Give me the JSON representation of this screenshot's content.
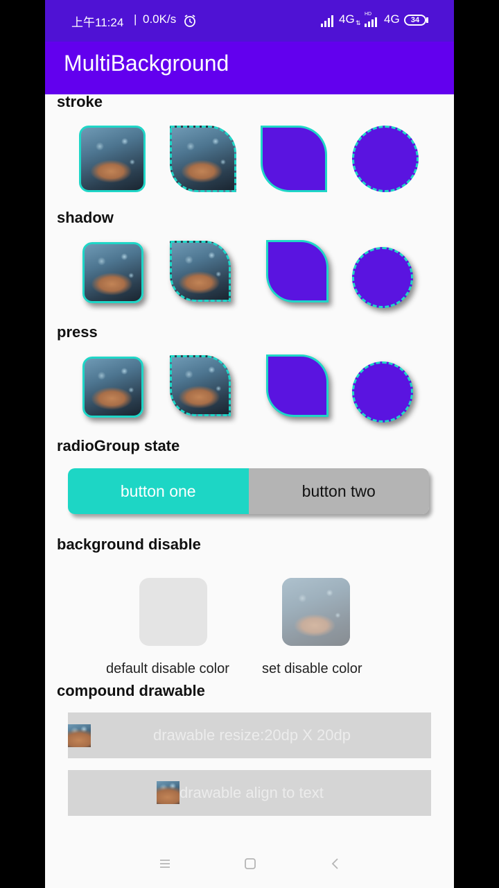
{
  "status_bar": {
    "time": "上午11:24",
    "net_speed": "0.0K/s",
    "network_1": "4G",
    "network_2": "4G",
    "battery": "34",
    "hd_label": "HD"
  },
  "app_bar": {
    "title": "MultiBackground"
  },
  "sections": {
    "stroke": "stroke",
    "shadow": "shadow",
    "press": "press",
    "radio": "radioGroup state",
    "disable": "background disable",
    "compound": "compound drawable"
  },
  "radio_group": {
    "options": [
      "button one",
      "button two"
    ],
    "selected_index": 0
  },
  "disable": {
    "captions": [
      "default disable color",
      "set disable color"
    ]
  },
  "compound": {
    "buttons": [
      "drawable resize:20dp X 20dp",
      "drawable align to text"
    ]
  },
  "colors": {
    "status_bar": "#4f12d4",
    "app_bar": "#6200ee",
    "purple_fill": "#5a14e0",
    "stroke_teal": "#1fd6c7",
    "radio_selected": "#1dd6c5",
    "radio_unselected": "#b4b4b4",
    "disabled_gray": "#d5d5d5"
  },
  "icons": {
    "alarm": "alarm-clock-icon",
    "signal": "signal-bars-icon",
    "battery": "battery-icon",
    "nav_menu": "menu-icon",
    "nav_home": "home-square-icon",
    "nav_back": "back-chevron-icon"
  }
}
